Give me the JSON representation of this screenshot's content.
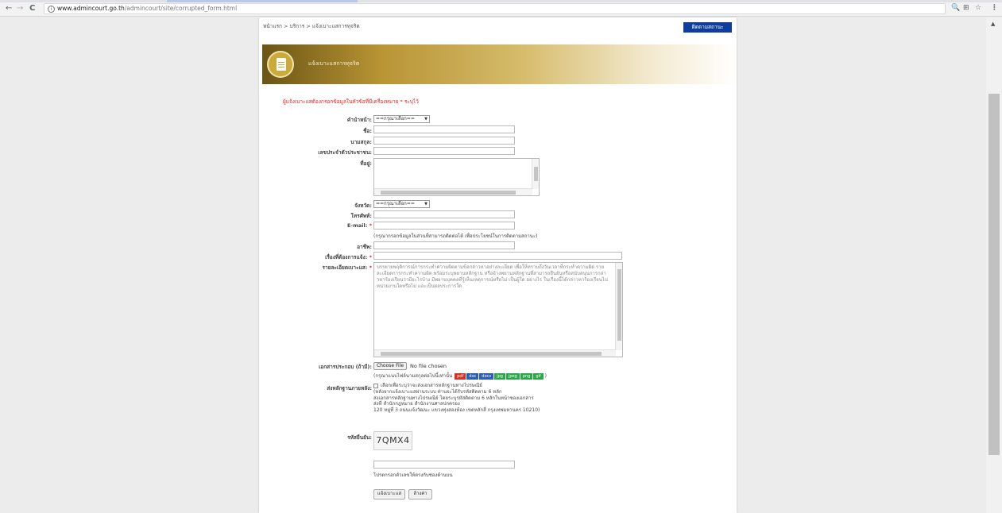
{
  "browser": {
    "back_icon": "←",
    "forward_icon": "→",
    "reload_icon": "C",
    "url_host": "www.admincourt.go.th",
    "url_path": "/admincourt/site/corrupted_form.html",
    "zoom_icon": "🔍",
    "translate_icon": "⊞",
    "star_icon": "☆",
    "menu_icon": "⋮"
  },
  "header": {
    "breadcrumb": "หน้าแรก > บริการ > แจ้งเบาะแสการทุจริต",
    "status_button": "ติดตามสถานะ",
    "banner_title": "แจ้งเบาะแสการทุจริต"
  },
  "form": {
    "required_note": "ผู้แจ้งเบาะแสต้องกรอกข้อมูลในหัวข้อที่มีเครื่องหมาย * ระบุไว้",
    "prefix_label": "คำนำหน้า:",
    "prefix_value": "==กรุณาเลือก== ",
    "firstname_label": "ชื่อ:",
    "lastname_label": "นามสกุล:",
    "idcard_label": "เลขประจำตัวประชาชน:",
    "address_label": "ที่อยู่:",
    "province_label": "จังหวัด:",
    "province_value": "==กรุณาเลือก== ",
    "phone_label": "โทรศัพท์:",
    "email_label": "E-mail:",
    "email_hint": "(กรุณากรอกข้อมูลในส่วนที่สามารถติดต่อได้ เพื่อประโยชน์ในการติดตามสถานะ)",
    "occupation_label": "อาชีพ:",
    "subject_label": "เรื่องที่ต้องการแจ้ง:",
    "detail_label": "รายละเอียดเบาะแส:",
    "detail_placeholder": "บรรยายพฤติการณ์การกระทำความผิดตามข้อกล่าวหาอย่างละเอียด เพื่อให้ทราบถึงวันเวลาที่กระทำความผิด รายละเอียดการกระทำความผิด พร้อมระบุพยานหลักฐาน หรืออ้างพยานหลักฐานที่สามารถยืนยันหรือสนับสนุนการกล่าวหาร้องเรียนว่ามีอะไรบ้าง มีพยานบุคคลที่รู้เห็นเหตุการณ์หรือไม่ เป็นผู้ใด อย่างไร ในเรื่องนี้ได้กล่าวหาร้องเรียนไปหน่วยงานใดหรือไม่ และเป็นผลประการใด",
    "attachment_label": "เอกสารประกอบ (ถ้ามี):",
    "choose_file": "Choose File",
    "no_file": "No file chosen",
    "filetypes_prefix": "(กรุณาแนบไฟล์นามสกุลต่อไปนี้เท่านั้น",
    "filetypes_suffix": ")",
    "filetypes": [
      "pdf",
      "doc",
      "docx",
      "jpg",
      "jpeg",
      "png",
      "gif"
    ],
    "filetype_colors": [
      "#d93025",
      "#2b5fb4",
      "#2b5fb4",
      "#2aa84a",
      "#2aa84a",
      "#2aa84a",
      "#2aa84a"
    ],
    "mail_evidence_label": "ส่งหลักฐานภายหลัง:",
    "mail_lines": [
      "เลือกเพื่อระบุว่าจะส่งเอกสารหลักฐานทางไปรษณีย์",
      "(หลังจากแจ้งเบาะแสผ่านระบบ ท่านจะได้รับรหัสติดตาม 6 หลัก",
      "ส่งเอกสารหลักฐานทางไปรษณีย์ โดยระบุรหัสติดตาม 6 หลักในหน้าซองเอกสาร",
      "ส่งที่ สำนักกฎหมาย สำนักงานศาลปกครอง",
      "120 หมู่ที่ 3 ถนนแจ้งวัฒนะ แขวงทุ่งสองห้อง เขตหลักสี่ กรุงเทพมหานคร 10210)"
    ],
    "captcha_label": "รหัสยืนยัน:",
    "captcha_code": "7QMX4",
    "captcha_hint": "โปรดกรอกตัวเลขให้ตรงกับช่องด้านบน",
    "submit_label": "แจ้งเบาะแส",
    "reset_label": "ล้างค่า"
  }
}
